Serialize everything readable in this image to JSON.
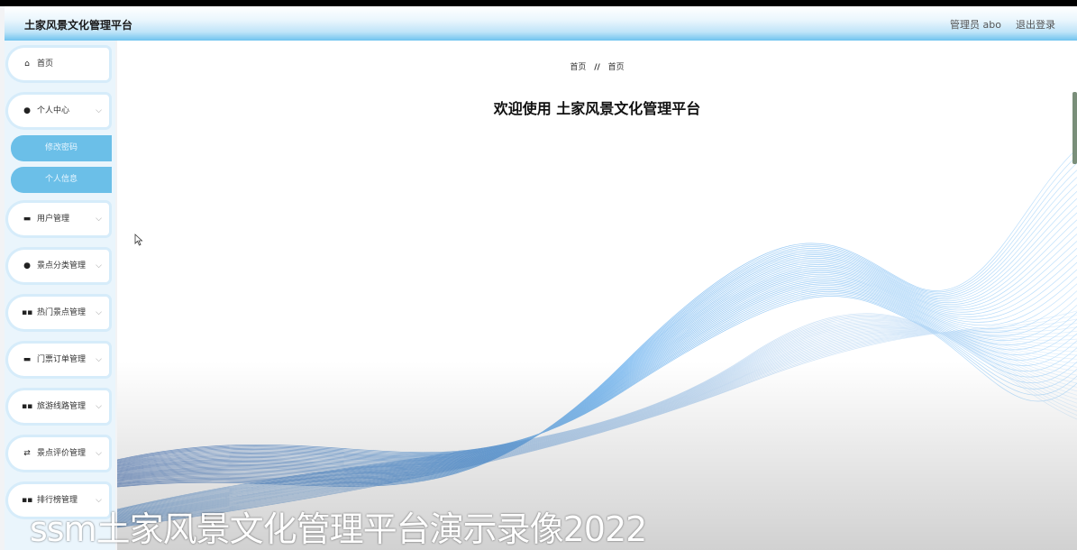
{
  "header": {
    "title": "土家风景文化管理平台",
    "user": "管理员 abo",
    "logout": "退出登录"
  },
  "sidebar": {
    "items": [
      {
        "label": "首页",
        "icon": "home-icon",
        "glyph": "⌂",
        "expandable": false
      },
      {
        "label": "个人中心",
        "icon": "person-icon",
        "glyph": "●",
        "expandable": true
      },
      {
        "label": "用户管理",
        "icon": "monitor-icon",
        "glyph": "▬",
        "expandable": true
      },
      {
        "label": "景点分类管理",
        "icon": "person-icon",
        "glyph": "●",
        "expandable": true
      },
      {
        "label": "热门景点管理",
        "icon": "grid-icon",
        "glyph": "▪▪",
        "expandable": true
      },
      {
        "label": "门票订单管理",
        "icon": "monitor-icon",
        "glyph": "▬",
        "expandable": true
      },
      {
        "label": "旅游线路管理",
        "icon": "grid-icon",
        "glyph": "▪▪",
        "expandable": true
      },
      {
        "label": "景点评价管理",
        "icon": "arrows-icon",
        "glyph": "⇄",
        "expandable": true
      },
      {
        "label": "排行榜管理",
        "icon": "grid-icon",
        "glyph": "▪▪",
        "expandable": true
      }
    ],
    "subitems": [
      "修改密码",
      "个人信息"
    ],
    "chevron": "⌵"
  },
  "main": {
    "breadcrumb": [
      "首页",
      "首页"
    ],
    "breadcrumb_sep": "//",
    "welcome": "欢迎使用 土家风景文化管理平台"
  },
  "caption": "ssm土家风景文化管理平台演示录像2022",
  "colors": {
    "accent": "#6bbfe8",
    "header_bottom": "#6fc3ef",
    "wave": "#1e88e5"
  }
}
